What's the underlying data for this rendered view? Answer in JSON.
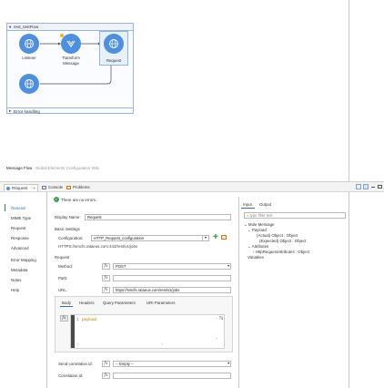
{
  "canvas": {
    "flow_title": "rest_testFlow",
    "nodes": [
      "Listener",
      "Transform Message",
      "Request"
    ],
    "error_label": "Error handling"
  },
  "view_tabs": [
    "Message Flow",
    "Global Elements",
    "Configuration XML"
  ],
  "panel": {
    "title": "Request",
    "tabs": [
      "Console",
      "Problems"
    ],
    "status": "There are no errors."
  },
  "sidenav": [
    "General",
    "MIME Type",
    "Request",
    "Response",
    "Advanced",
    "Error Mapping",
    "Metadata",
    "Notes",
    "Help"
  ],
  "form": {
    "display_name_label": "Display Name:",
    "display_name": "Request",
    "basic_settings": "Basic Settings",
    "configuration_label": "Configuration:",
    "configuration": "HTTP_Request_configuration",
    "config_url": "HTTPS://smcfs.rataeus.com:443/rest/v1/jobs",
    "request_heading": "Request",
    "method_label": "Method:",
    "method": "POST",
    "path_label": "Path:",
    "path": "",
    "url_label": "URL:",
    "url": "https://smcfs.rataeus.com/rest/v1/jobs",
    "subtabs": [
      "Body",
      "Headers",
      "Query Parameters",
      "URI Parameters"
    ],
    "code_line_no": "1",
    "code": "payload",
    "send_corr_label": "Send correlation id:",
    "send_corr": "-- Empty --",
    "corr_label": "Correlation id:",
    "fx": "fx"
  },
  "right": {
    "tabs": [
      "Input",
      "Output"
    ],
    "filter_placeholder": "type filter text",
    "tree": [
      "Mule Message",
      "Payload",
      "(Actual) Object : Object",
      "(Expected) Object : Object",
      "Attributes",
      "HttpRequestAttributes : Object",
      "Variables"
    ]
  },
  "colors": {
    "accent": "#4f8fe0",
    "link": "#2a6ebd",
    "tab_active": "#2a6ebd"
  }
}
